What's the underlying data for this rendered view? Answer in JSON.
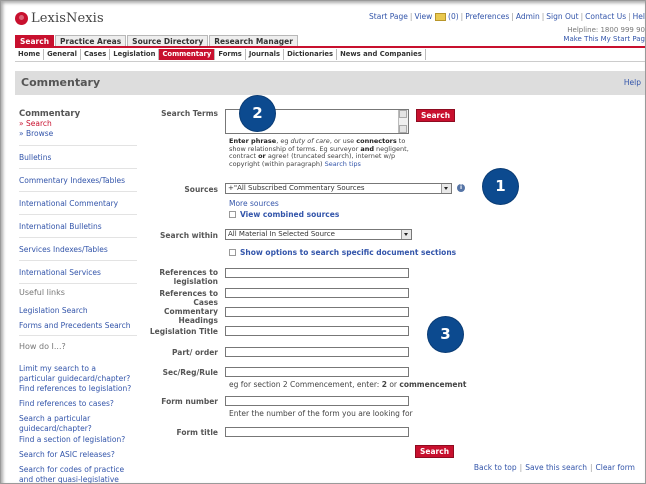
{
  "header": {
    "logo": "LexisNexis",
    "top_links": [
      "Start Page",
      "View",
      "(0)",
      "Preferences",
      "Admin",
      "Sign Out",
      "Contact Us",
      "Hel"
    ],
    "helpline": "Helpline: 1800 999 90",
    "make_start_page": "Make This My Start Pag"
  },
  "main_tabs": [
    "Search",
    "Practice Areas",
    "Source Directory",
    "Research Manager"
  ],
  "sub_tabs": [
    "Home",
    "General",
    "Cases",
    "Legislation",
    "Commentary",
    "Forms",
    "Journals",
    "Dictionaries",
    "News and Companies"
  ],
  "page": {
    "title": "Commentary",
    "help": "Help"
  },
  "sidebar": {
    "title": "Commentary",
    "search": "» Search",
    "browse": "» Browse",
    "links": [
      "Bulletins",
      "Commentary Indexes/Tables",
      "International Commentary",
      "International Bulletins",
      "Services Indexes/Tables",
      "International Services"
    ],
    "useful_links_heading": "Useful links",
    "useful_links": [
      "Legislation Search",
      "Forms and Precedents Search"
    ],
    "howdoi_heading": "How do I...?",
    "howdoi": [
      "Limit my search to a particular guidecard/chapter?",
      "Find references to legislation?",
      "Find references to cases?",
      "Search a particular guidecard/chapter?",
      "Find a section of legislation?",
      "Search for ASIC releases?",
      "Search for codes of practice and other quasi-legislative"
    ]
  },
  "form": {
    "search_terms_label": "Search Terms",
    "search_button": "Search",
    "hint_line1_bold": "Enter phrase",
    "hint_line1_rest": ", eg ",
    "hint_example1": "duty of care",
    "hint_or_use": ", or use",
    "hint_connectors": "connectors",
    "hint_line2": " to show relationship of terms. Eg surveyor ",
    "hint_and": "and",
    "hint_line3": " negligent, contract ",
    "hint_or": "or",
    "hint_agree": " agree! (truncated search), internet w/p copyright (within paragraph) ",
    "hint_search_tips": "Search tips",
    "sources_label": "Sources",
    "sources_value": "+\"All Subscribed Commentary Sources",
    "more_sources": "More sources",
    "view_combined": "View combined sources",
    "search_within_label": "Search within",
    "search_within_value": "All Material In Selected Source",
    "show_options": "Show options to search specific document sections",
    "references_legislation": "References to legislation",
    "references_cases": "References to Cases",
    "commentary_headings": "Commentary Headings",
    "legislation_title": "Legislation Title",
    "part_order": "Part/ order",
    "sec_reg_rule": "Sec/Reg/Rule",
    "sec_hint_pre": "eg for section 2 Commencement, enter: ",
    "sec_hint_2": "2",
    "sec_hint_or": " or ",
    "sec_hint_commencement": "commencement",
    "form_number": "Form number",
    "form_number_hint": "Enter the number of the form you are looking for",
    "form_title": "Form title",
    "bottom_search": "Search"
  },
  "footer_links": [
    "Back to top",
    "Save this search",
    "Clear form"
  ],
  "badges": [
    "1",
    "2",
    "3"
  ],
  "colors": {
    "brand_red": "#c8102e",
    "badge_blue": "#0c4a8f",
    "link_blue": "#3355aa"
  }
}
